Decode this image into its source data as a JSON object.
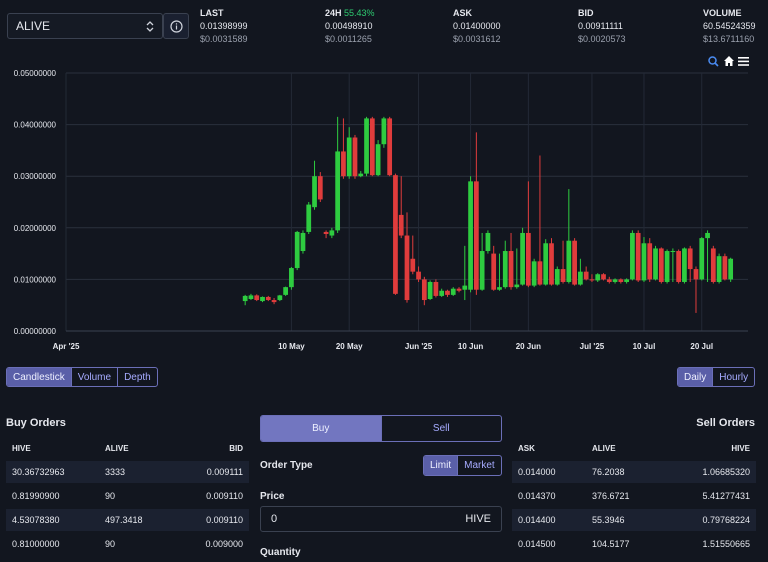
{
  "token_select": {
    "value": "ALIVE"
  },
  "stats": [
    {
      "label": "LAST",
      "label_extra": "",
      "v1": "0.01398999",
      "v2": "$0.0031589",
      "v1_green": false
    },
    {
      "label": "24H",
      "label_extra": "55.43%",
      "v1": "0.00498910",
      "v2": "$0.0011265",
      "v1_green": true
    },
    {
      "label": "ASK",
      "label_extra": "",
      "v1": "0.01400000",
      "v2": "$0.0031612",
      "v1_green": false
    },
    {
      "label": "BID",
      "label_extra": "",
      "v1": "0.00911111",
      "v2": "$0.0020573",
      "v1_green": false
    },
    {
      "label": "VOLUME",
      "label_extra": "",
      "v1": "60.54524359",
      "v2": "$13.6711160",
      "v1_green": false
    }
  ],
  "chart_data": {
    "type": "candlestick",
    "y_ticks": [
      "0.05000000",
      "0.04000000",
      "0.03000000",
      "0.02000000",
      "0.01000000",
      "0.00000000"
    ],
    "ylim": [
      0,
      0.05
    ],
    "x_ticks": [
      {
        "label": "Apr '25",
        "day": 0
      },
      {
        "label": "10 May",
        "day": 39
      },
      {
        "label": "20 May",
        "day": 49
      },
      {
        "label": "Jun '25",
        "day": 61
      },
      {
        "label": "10 Jun",
        "day": 70
      },
      {
        "label": "20 Jun",
        "day": 80
      },
      {
        "label": "Jul '25",
        "day": 91
      },
      {
        "label": "10 Jul",
        "day": 100
      },
      {
        "label": "20 Jul",
        "day": 110
      }
    ],
    "up_color": "#2ecc40",
    "down_color": "#e03c3c",
    "candles": [
      [
        31,
        0.0058,
        0.0068,
        0.005,
        0.007
      ],
      [
        32,
        0.0062,
        0.0069,
        0.006,
        0.0072
      ],
      [
        33,
        0.0069,
        0.006,
        0.0058,
        0.0071
      ],
      [
        34,
        0.0058,
        0.0066,
        0.0056,
        0.0067
      ],
      [
        35,
        0.0066,
        0.006,
        0.0058,
        0.0068
      ],
      [
        36,
        0.006,
        0.0056,
        0.0052,
        0.0064
      ],
      [
        37,
        0.006,
        0.0069,
        0.0058,
        0.007
      ],
      [
        38,
        0.007,
        0.0085,
        0.0068,
        0.0086
      ],
      [
        39,
        0.0085,
        0.0122,
        0.008,
        0.0124
      ],
      [
        40,
        0.0122,
        0.0192,
        0.0118,
        0.0194
      ],
      [
        41,
        0.0155,
        0.019,
        0.015,
        0.0195
      ],
      [
        42,
        0.0192,
        0.0245,
        0.0188,
        0.025
      ],
      [
        43,
        0.024,
        0.03,
        0.0235,
        0.033
      ],
      [
        44,
        0.03,
        0.0255,
        0.025,
        0.0308
      ],
      [
        45,
        0.0192,
        0.0188,
        0.018,
        0.0195
      ],
      [
        46,
        0.0185,
        0.0195,
        0.018,
        0.02
      ],
      [
        47,
        0.0195,
        0.0348,
        0.019,
        0.0415
      ],
      [
        48,
        0.0348,
        0.03,
        0.0295,
        0.0412
      ],
      [
        49,
        0.03,
        0.0375,
        0.0295,
        0.0395
      ],
      [
        50,
        0.0375,
        0.03,
        0.0295,
        0.038
      ],
      [
        51,
        0.03,
        0.0305,
        0.0298,
        0.031
      ],
      [
        52,
        0.0305,
        0.0412,
        0.03,
        0.0415
      ],
      [
        53,
        0.0412,
        0.0302,
        0.03,
        0.0415
      ],
      [
        54,
        0.0302,
        0.0362,
        0.03,
        0.037
      ],
      [
        55,
        0.0362,
        0.0412,
        0.0355,
        0.0415
      ],
      [
        56,
        0.0412,
        0.0302,
        0.03,
        0.0415
      ],
      [
        57,
        0.0302,
        0.0072,
        0.007,
        0.0305
      ],
      [
        58,
        0.0225,
        0.0185,
        0.018,
        0.03
      ],
      [
        59,
        0.0185,
        0.006,
        0.0055,
        0.023
      ],
      [
        60,
        0.014,
        0.0115,
        0.011,
        0.0185
      ],
      [
        61,
        0.0115,
        0.01,
        0.0095,
        0.0125
      ],
      [
        62,
        0.01,
        0.006,
        0.005,
        0.0105
      ],
      [
        63,
        0.0062,
        0.0095,
        0.006,
        0.0098
      ],
      [
        64,
        0.0095,
        0.0068,
        0.0065,
        0.01
      ],
      [
        65,
        0.0068,
        0.0078,
        0.0066,
        0.0082
      ],
      [
        66,
        0.0078,
        0.007,
        0.0066,
        0.008
      ],
      [
        67,
        0.007,
        0.0082,
        0.0068,
        0.0085
      ],
      [
        68,
        0.0082,
        0.0078,
        0.0075,
        0.0085
      ],
      [
        69,
        0.008,
        0.0088,
        0.006,
        0.0165
      ],
      [
        70,
        0.008,
        0.029,
        0.0075,
        0.03
      ],
      [
        71,
        0.029,
        0.008,
        0.007,
        0.0385
      ],
      [
        72,
        0.008,
        0.0155,
        0.0078,
        0.019
      ],
      [
        73,
        0.0155,
        0.019,
        0.015,
        0.0195
      ],
      [
        74,
        0.015,
        0.008,
        0.0078,
        0.0165
      ],
      [
        75,
        0.008,
        0.0085,
        0.0078,
        0.015
      ],
      [
        76,
        0.0085,
        0.0155,
        0.0082,
        0.0175
      ],
      [
        77,
        0.0155,
        0.0085,
        0.008,
        0.019
      ],
      [
        78,
        0.0085,
        0.009,
        0.0082,
        0.016
      ],
      [
        79,
        0.009,
        0.019,
        0.0088,
        0.02
      ],
      [
        80,
        0.019,
        0.0088,
        0.0085,
        0.029
      ],
      [
        81,
        0.0088,
        0.0135,
        0.0085,
        0.014
      ],
      [
        82,
        0.0135,
        0.009,
        0.0088,
        0.034
      ],
      [
        83,
        0.009,
        0.017,
        0.0088,
        0.0178
      ],
      [
        84,
        0.017,
        0.009,
        0.0088,
        0.018
      ],
      [
        85,
        0.009,
        0.012,
        0.0088,
        0.0125
      ],
      [
        86,
        0.012,
        0.0095,
        0.0092,
        0.0175
      ],
      [
        87,
        0.0095,
        0.0175,
        0.0092,
        0.0275
      ],
      [
        88,
        0.0175,
        0.009,
        0.0088,
        0.018
      ],
      [
        89,
        0.009,
        0.0115,
        0.0088,
        0.014
      ],
      [
        90,
        0.0115,
        0.01,
        0.0098,
        0.0125
      ],
      [
        91,
        0.01,
        0.0098,
        0.0095,
        0.011
      ],
      [
        92,
        0.0098,
        0.011,
        0.0095,
        0.0112
      ],
      [
        93,
        0.011,
        0.01,
        0.0098,
        0.0112
      ],
      [
        94,
        0.01,
        0.0095,
        0.0092,
        0.0105
      ],
      [
        95,
        0.0095,
        0.01,
        0.0092,
        0.0102
      ],
      [
        96,
        0.01,
        0.0095,
        0.0092,
        0.0102
      ],
      [
        97,
        0.0095,
        0.01,
        0.0092,
        0.0102
      ],
      [
        98,
        0.01,
        0.019,
        0.0098,
        0.0195
      ],
      [
        99,
        0.019,
        0.0098,
        0.0095,
        0.0195
      ],
      [
        100,
        0.0098,
        0.017,
        0.0095,
        0.0182
      ],
      [
        101,
        0.017,
        0.01,
        0.0095,
        0.018
      ],
      [
        102,
        0.01,
        0.016,
        0.0098,
        0.0165
      ],
      [
        103,
        0.016,
        0.0095,
        0.0092,
        0.0162
      ],
      [
        104,
        0.0095,
        0.0155,
        0.0092,
        0.0158
      ],
      [
        105,
        0.0155,
        0.0155,
        0.0095,
        0.016
      ],
      [
        106,
        0.0155,
        0.0095,
        0.0092,
        0.0158
      ],
      [
        107,
        0.0095,
        0.016,
        0.0092,
        0.0162
      ],
      [
        108,
        0.016,
        0.012,
        0.0095,
        0.0165
      ],
      [
        109,
        0.012,
        0.01,
        0.0035,
        0.0125
      ],
      [
        110,
        0.01,
        0.018,
        0.0098,
        0.0182
      ],
      [
        111,
        0.018,
        0.019,
        0.0095,
        0.0195
      ],
      [
        112,
        0.016,
        0.0095,
        0.0092,
        0.0165
      ],
      [
        113,
        0.0095,
        0.0145,
        0.0092,
        0.015
      ],
      [
        114,
        0.0145,
        0.01,
        0.0098,
        0.015
      ],
      [
        115,
        0.01,
        0.014,
        0.0095,
        0.0142
      ]
    ]
  },
  "chart_tools": {
    "zoom_icon": "magnifier-icon",
    "home_icon": "home-icon",
    "menu_icon": "hamburger-menu-icon"
  },
  "chart_type_buttons": [
    "Candlestick",
    "Volume",
    "Depth"
  ],
  "interval_buttons": [
    "Daily",
    "Hourly"
  ],
  "buy_orders": {
    "title": "Buy Orders",
    "headers": [
      "HIVE",
      "ALIVE",
      "BID"
    ],
    "rows": [
      [
        "30.36732963",
        "3333",
        "0.009111"
      ],
      [
        "0.81990900",
        "90",
        "0.009110"
      ],
      [
        "4.53078380",
        "497.3418",
        "0.009110"
      ],
      [
        "0.81000000",
        "90",
        "0.009000"
      ]
    ]
  },
  "sell_orders": {
    "title": "Sell Orders",
    "headers": [
      "ASK",
      "ALIVE",
      "HIVE"
    ],
    "rows": [
      [
        "0.014000",
        "76.2038",
        "1.06685320"
      ],
      [
        "0.014370",
        "376.6721",
        "5.41277431"
      ],
      [
        "0.014400",
        "55.3946",
        "0.79768224"
      ],
      [
        "0.014500",
        "104.5177",
        "1.51550665"
      ]
    ]
  },
  "trade_form": {
    "tabs": [
      "Buy",
      "Sell"
    ],
    "order_type_label": "Order Type",
    "order_types": [
      "Limit",
      "Market"
    ],
    "price_label": "Price",
    "price_value": "0",
    "price_unit": "HIVE",
    "quantity_label": "Quantity"
  }
}
